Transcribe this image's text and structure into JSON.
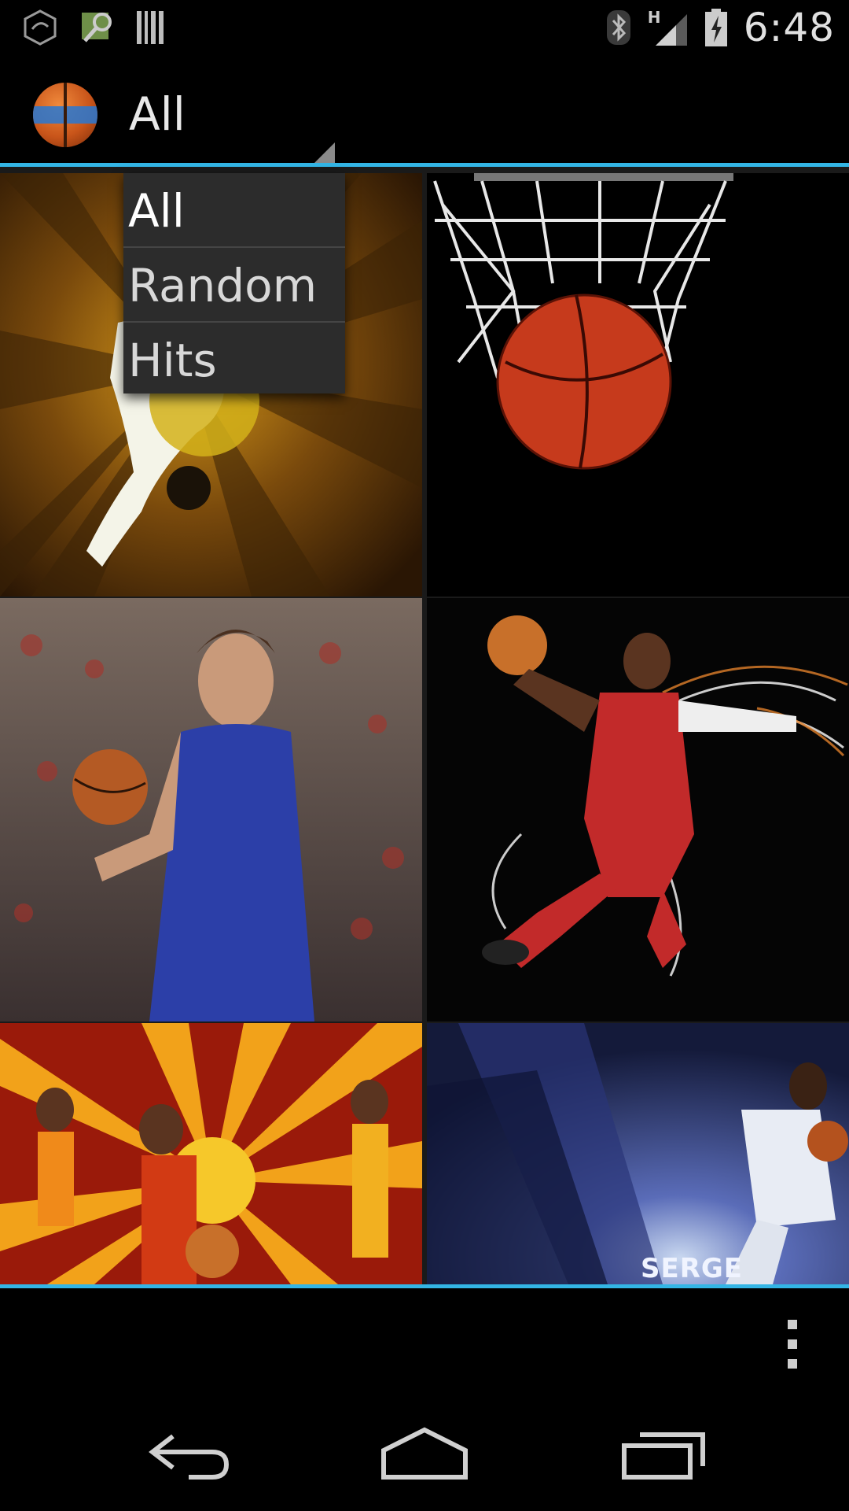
{
  "status_bar": {
    "time": "6:48",
    "network_type": "H",
    "icons": [
      "sync-icon",
      "map-icon",
      "barcode-icon",
      "bluetooth-icon",
      "signal-icon",
      "battery-icon"
    ]
  },
  "action_bar": {
    "logo_icon": "basketball-logo-icon",
    "spinner_selected": "All"
  },
  "dropdown": {
    "items": [
      {
        "label": "All"
      },
      {
        "label": "Random"
      },
      {
        "label": "Hits"
      }
    ]
  },
  "gallery": {
    "tiles": [
      {
        "name": "wallpaper-dunk-silhouette"
      },
      {
        "name": "wallpaper-ball-net"
      },
      {
        "name": "wallpaper-serbia-player"
      },
      {
        "name": "wallpaper-bulls-player"
      },
      {
        "name": "wallpaper-macedonia-team"
      },
      {
        "name": "wallpaper-serge"
      }
    ],
    "tile6_caption": "SERGE"
  },
  "colors": {
    "accent": "#33b5e5",
    "background": "#000000",
    "dropdown_bg": "#2c2c2c"
  },
  "nav_bar": {
    "icons": [
      "back-icon",
      "home-icon",
      "recents-icon"
    ]
  },
  "bottom_bar": {
    "icons": [
      "overflow-menu-icon"
    ]
  }
}
